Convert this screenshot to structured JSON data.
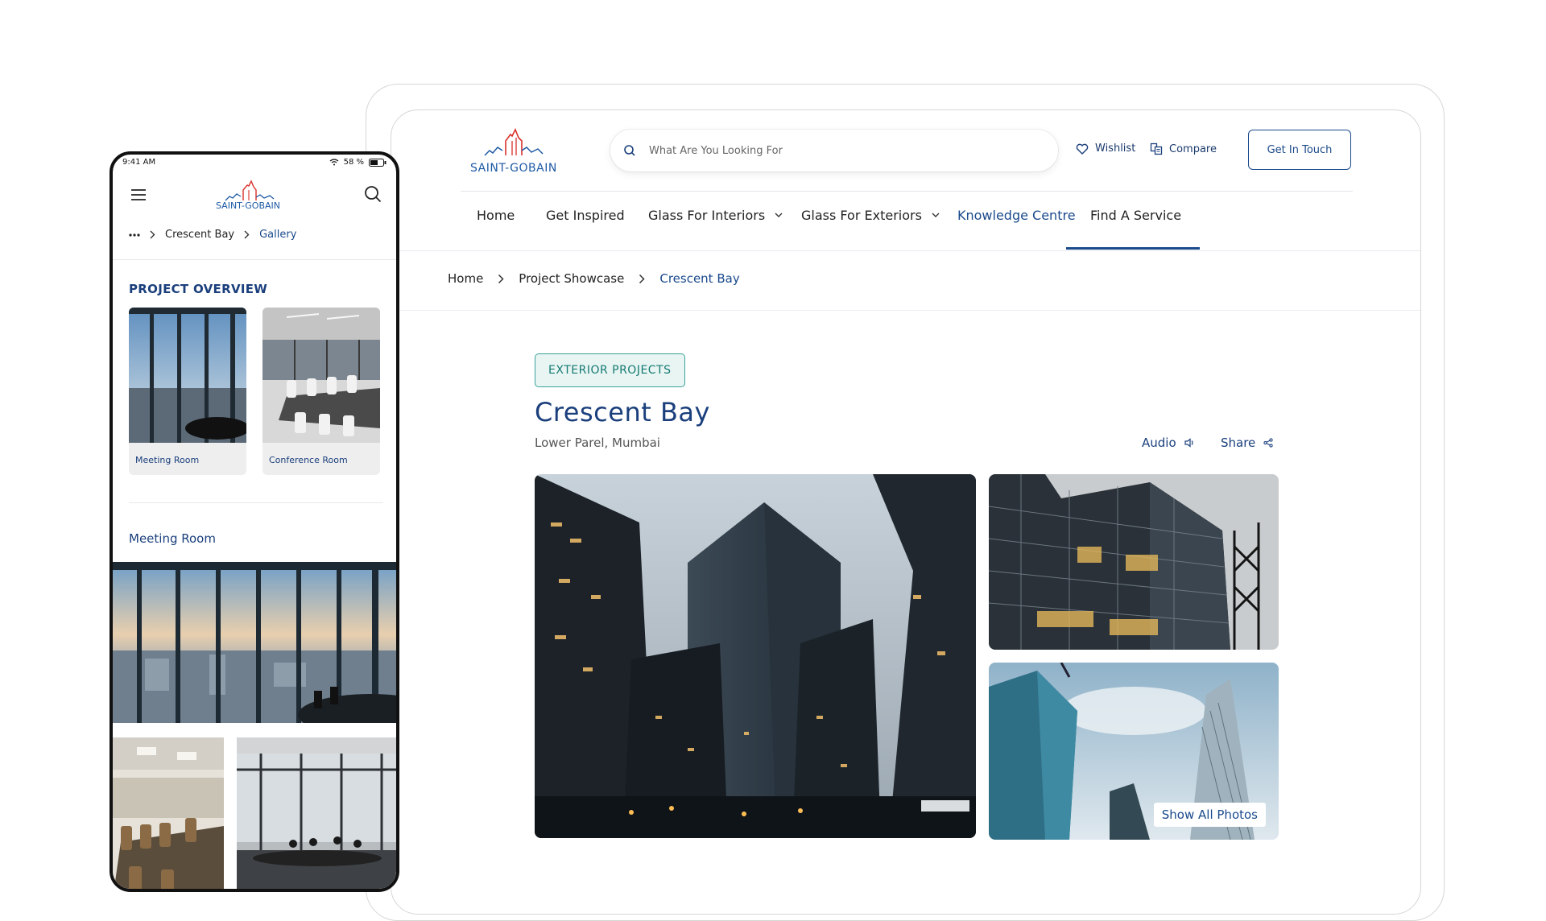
{
  "header": {
    "brand": "SAINT-GOBAIN",
    "search_placeholder": "What Are You Looking For",
    "wishlist": "Wishlist",
    "compare": "Compare",
    "cta": "Get In Touch"
  },
  "nav": {
    "items": [
      "Home",
      "Get Inspired",
      "Glass For Interiors",
      "Glass For Exteriors",
      "Knowledge Centre",
      "Find A Service"
    ],
    "active": "Knowledge Centre"
  },
  "breadcrumb": [
    "Home",
    "Project Showcase",
    "Crescent Bay"
  ],
  "project": {
    "category": "EXTERIOR PROJECTS",
    "title": "Crescent Bay",
    "location": "Lower Parel, Mumbai",
    "audio_label": "Audio",
    "share_label": "Share",
    "show_all": "Show All Photos"
  },
  "phone": {
    "status_time": "9:41 AM",
    "battery": "58 %",
    "brand": "SAINT-GOBAIN",
    "breadcrumb": [
      "Crescent Bay",
      "Gallery"
    ],
    "section_title": "PROJECT OVERVIEW",
    "cards": [
      "Meeting Room",
      "Conference Room"
    ],
    "section_heading": "Meeting Room"
  },
  "colors": {
    "brand_blue": "#1a3f7c",
    "accent_blue": "#1a4a8c",
    "teal": "#3aa39a",
    "logo_red": "#d9312b"
  }
}
